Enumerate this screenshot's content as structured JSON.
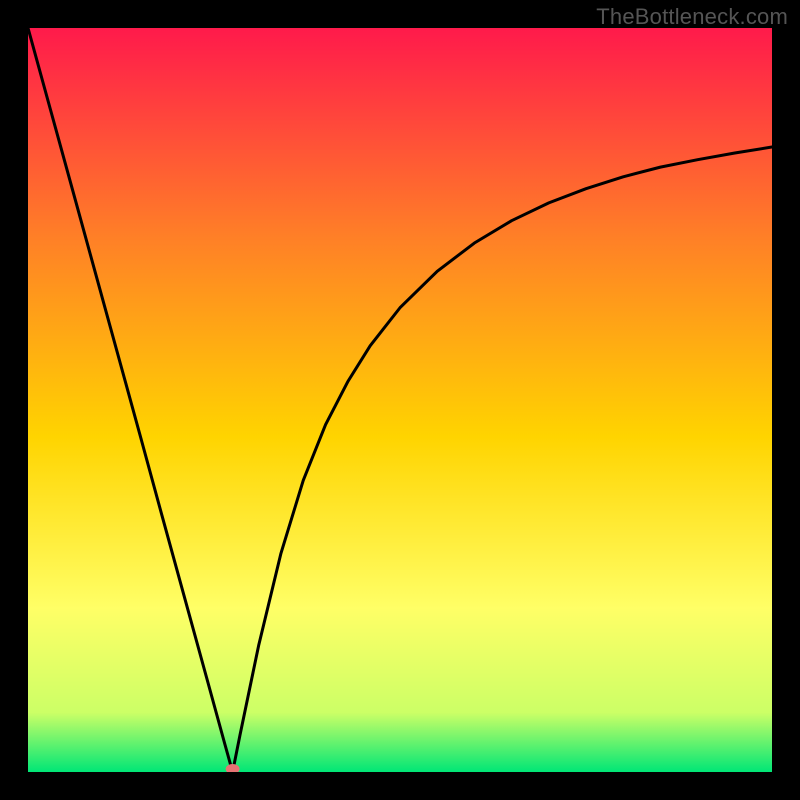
{
  "watermark": "TheBottleneck.com",
  "chart_data": {
    "type": "line",
    "title": "",
    "xlabel": "",
    "ylabel": "",
    "xlim": [
      0,
      1
    ],
    "ylim": [
      0,
      1
    ],
    "legend": false,
    "grid": false,
    "background_gradient": {
      "top": "#ff1a4b",
      "mid_upper": "#ff7f27",
      "mid": "#ffd400",
      "mid_lower": "#ffff66",
      "near_bottom": "#ccff66",
      "bottom": "#00e676"
    },
    "marker": {
      "x": 0.275,
      "y": 0.0,
      "color": "#e57373",
      "size": 8
    },
    "series": [
      {
        "name": "curve",
        "color": "#000000",
        "x": [
          0.0,
          0.03,
          0.06,
          0.09,
          0.12,
          0.15,
          0.18,
          0.21,
          0.24,
          0.265,
          0.275,
          0.285,
          0.31,
          0.34,
          0.37,
          0.4,
          0.43,
          0.46,
          0.5,
          0.55,
          0.6,
          0.65,
          0.7,
          0.75,
          0.8,
          0.85,
          0.9,
          0.95,
          1.0
        ],
        "values": [
          1.0,
          0.891,
          0.782,
          0.673,
          0.564,
          0.455,
          0.345,
          0.236,
          0.127,
          0.036,
          0.0,
          0.05,
          0.17,
          0.294,
          0.392,
          0.467,
          0.525,
          0.573,
          0.624,
          0.673,
          0.711,
          0.741,
          0.765,
          0.784,
          0.8,
          0.813,
          0.823,
          0.832,
          0.84
        ]
      }
    ]
  }
}
